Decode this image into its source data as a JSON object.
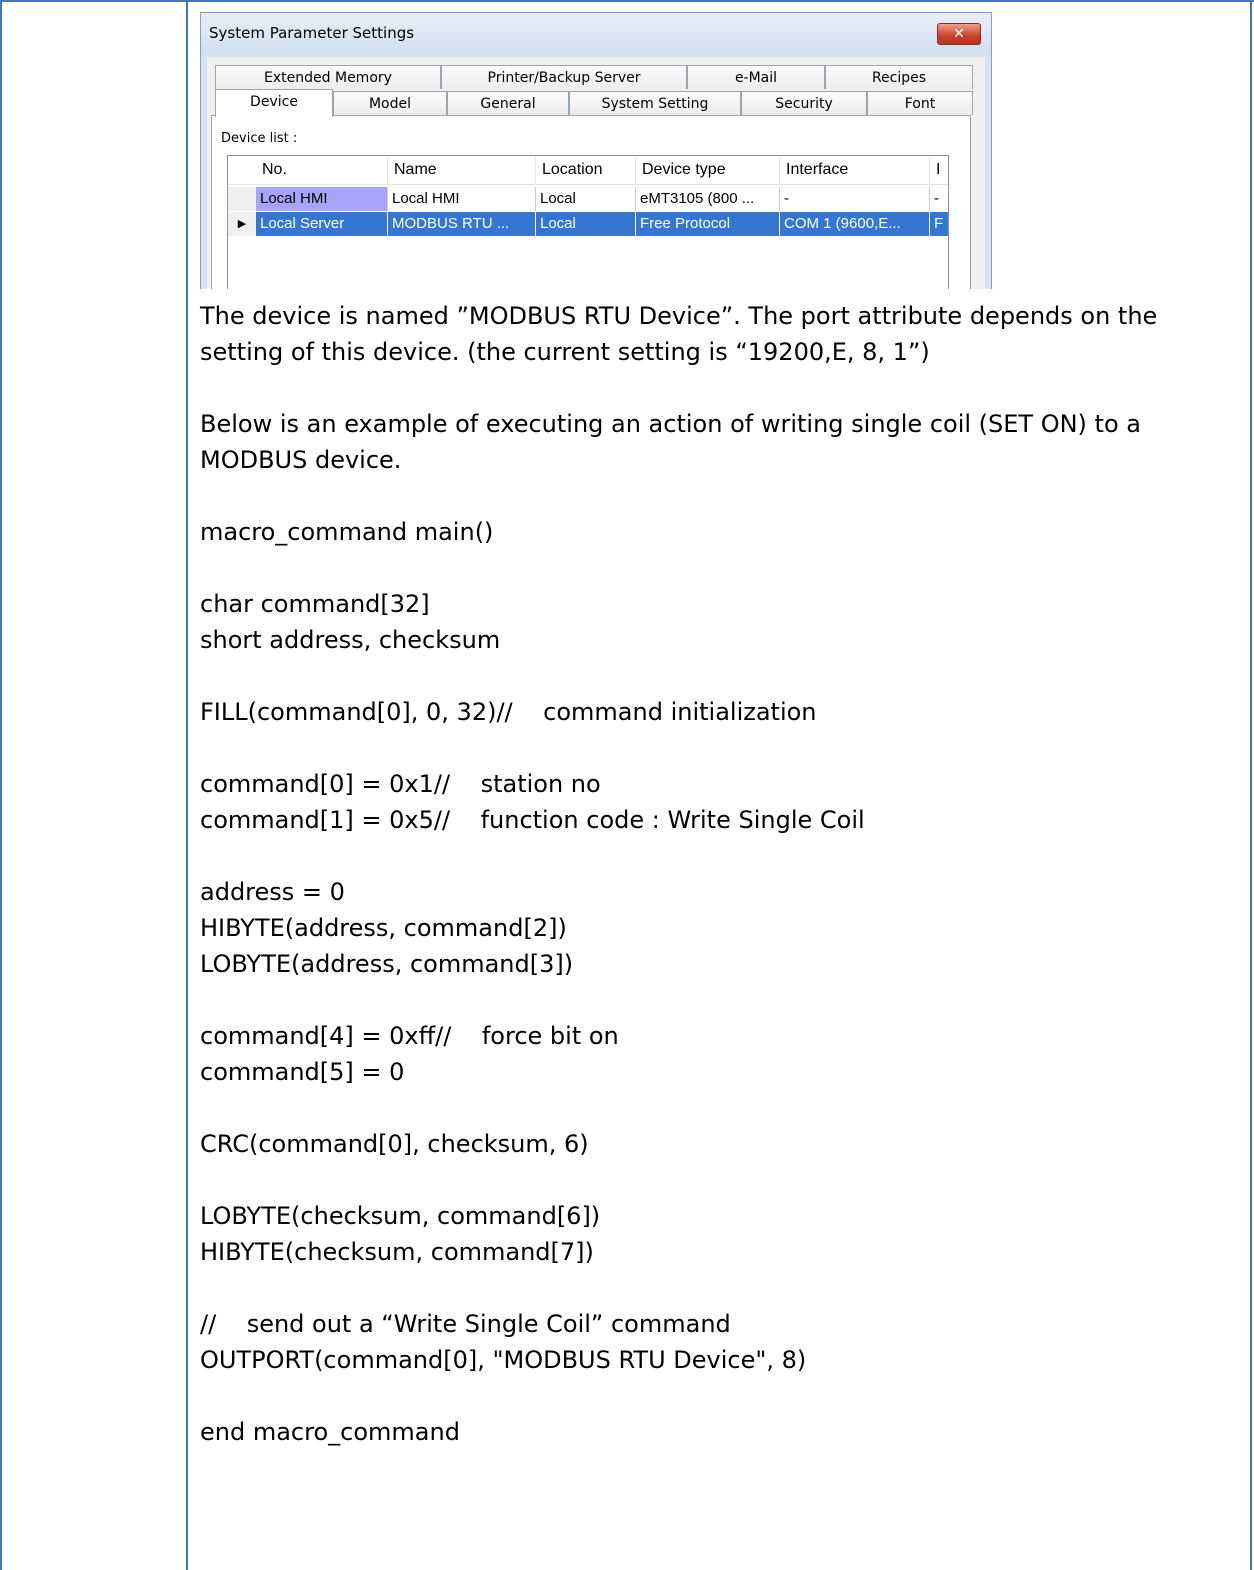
{
  "dialog": {
    "title": "System Parameter Settings",
    "close_glyph": "✕",
    "tabs_row1": [
      "Extended Memory",
      "Printer/Backup Server",
      "e-Mail",
      "Recipes"
    ],
    "tabs_row2": [
      "Device",
      "Model",
      "General",
      "System Setting",
      "Security",
      "Font"
    ],
    "active_tab": "Device",
    "device_list_label": "Device list :",
    "columns": [
      "No.",
      "Name",
      "Location",
      "Device type",
      "Interface",
      "I"
    ],
    "rows": [
      {
        "no": "Local HMI",
        "name": "Local HMI",
        "location": "Local",
        "type": "eMT3105 (800 ...",
        "interface": "-",
        "extra": "-"
      },
      {
        "no": "Local Server",
        "name": "MODBUS RTU ...",
        "location": "Local",
        "type": "Free Protocol",
        "interface": "COM 1 (9600,E...",
        "extra": "F"
      }
    ],
    "row_pointer": "▶"
  },
  "document": {
    "paragraphs": [
      "The device is named ”MODBUS RTU Device”. The port attribute depends on the setting of this device. (the current setting is “19200,E, 8, 1”)",
      "Below is an example of executing an action of writing single coil (SET ON) to a MODBUS device.",
      "macro_command main()",
      "char command[32]\nshort address, checksum",
      "FILL(command[0], 0, 32)//    command initialization",
      "command[0] = 0x1//    station no\ncommand[1] = 0x5//    function code : Write Single Coil",
      "address = 0\nHIBYTE(address, command[2])\nLOBYTE(address, command[3])",
      "command[4] = 0xff//    force bit on\ncommand[5] = 0",
      "CRC(command[0], checksum, 6)",
      "LOBYTE(checksum, command[6])\nHIBYTE(checksum, command[7])",
      "//    send out a “Write Single Coil” command\nOUTPORT(command[0], \"MODBUS RTU Device\", 8)",
      "end macro_command"
    ]
  }
}
